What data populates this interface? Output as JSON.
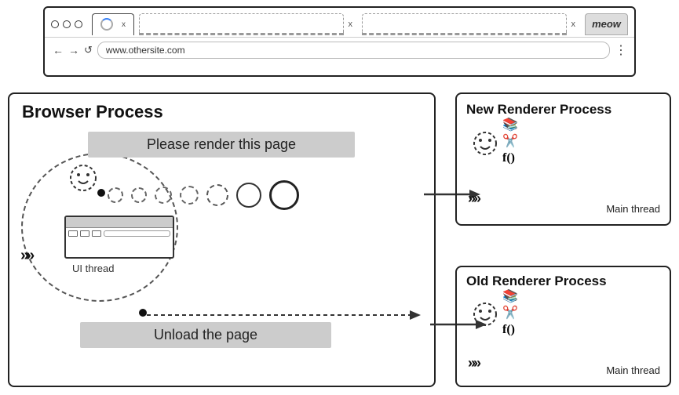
{
  "browser_chrome": {
    "tab1": {
      "loading": true,
      "close": "x"
    },
    "tab2_close": "x",
    "tab3_close": "x",
    "meow_label": "meow",
    "address": "www.othersite.com"
  },
  "diagram": {
    "browser_process_label": "Browser Process",
    "new_renderer_label": "New Renderer Process",
    "old_renderer_label": "Old Renderer Process",
    "message_please_render": "Please render this page",
    "message_unload": "Unload the page",
    "ui_thread_label": "UI thread",
    "main_thread_label_new": "Main thread",
    "main_thread_label_old": "Main thread"
  }
}
